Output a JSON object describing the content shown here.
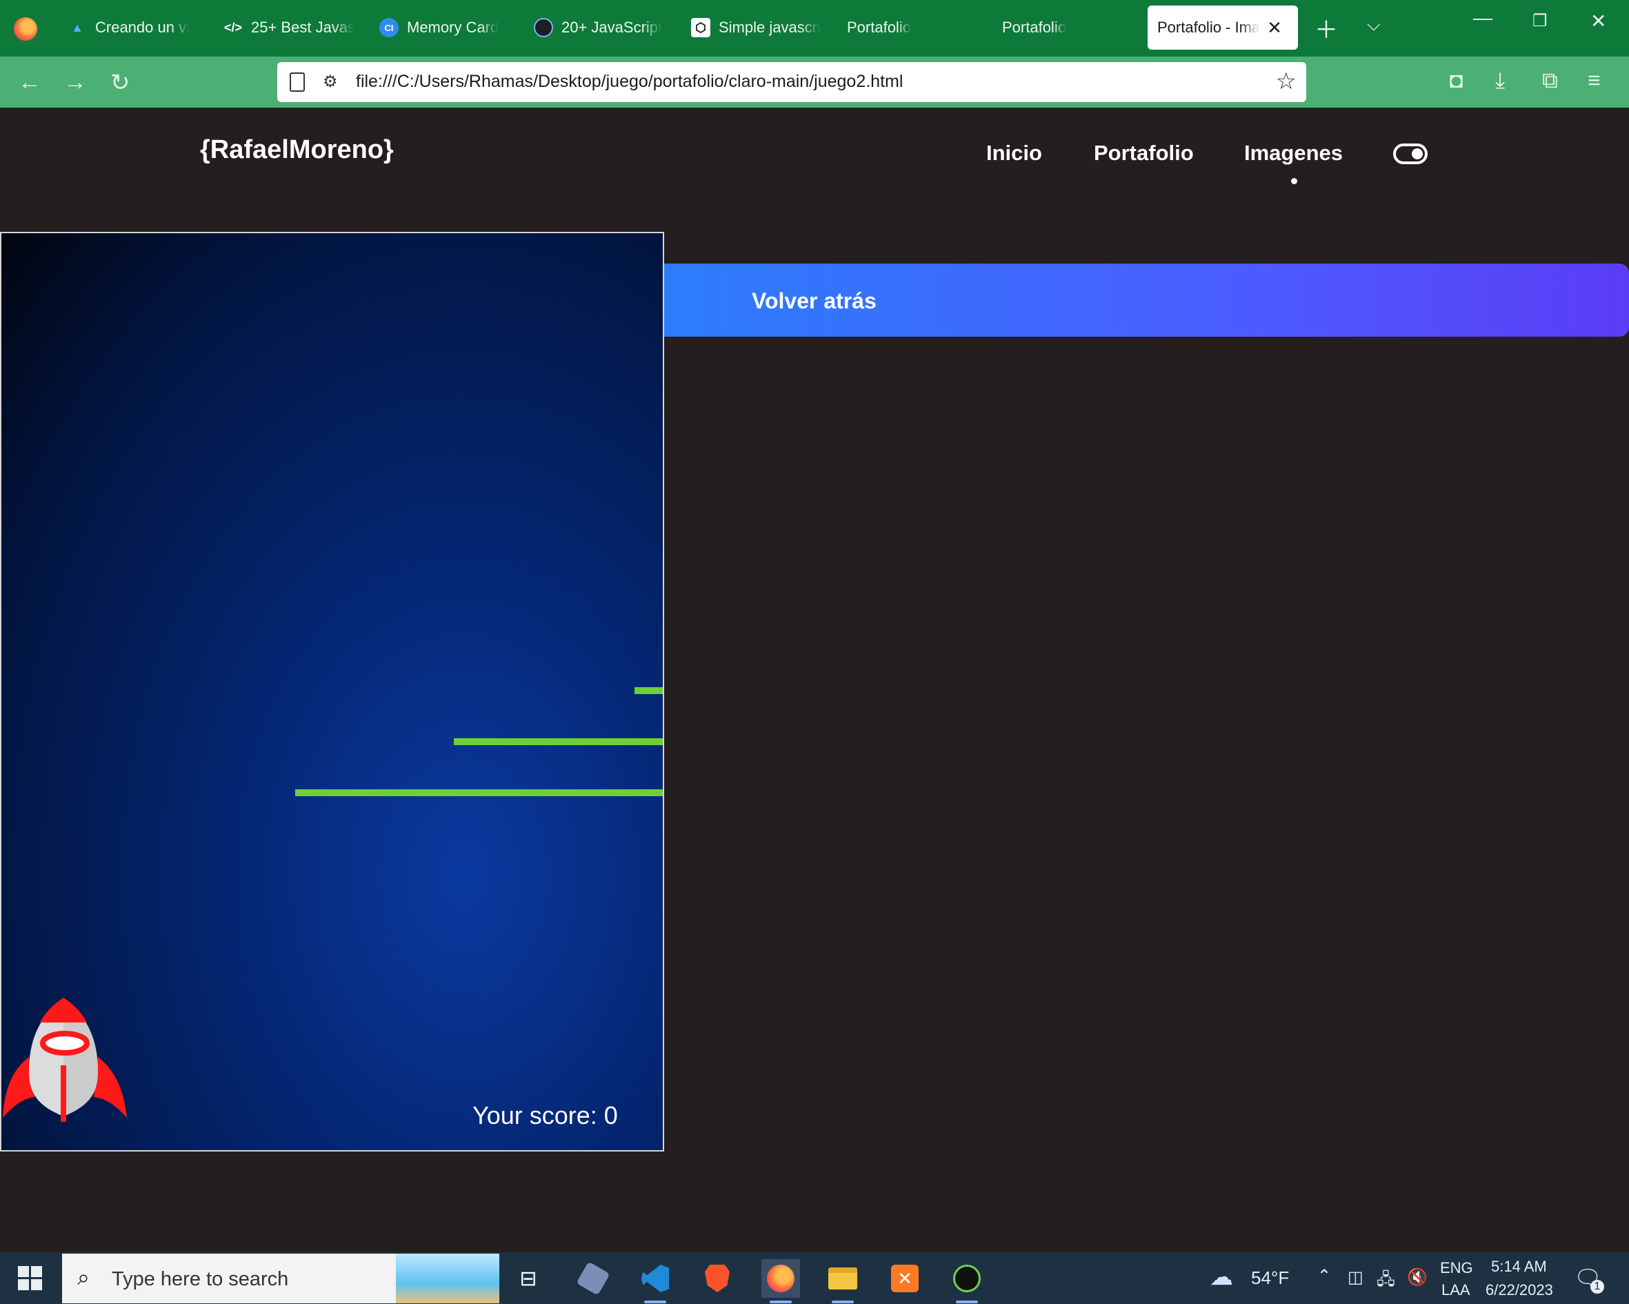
{
  "browser": {
    "tabs": [
      {
        "label": "Creando un vi",
        "icon": "triangle-a-icon",
        "active": false
      },
      {
        "label": "25+ Best Javas",
        "icon": "code-icon",
        "active": false
      },
      {
        "label": "Memory Card",
        "icon": "card-icon",
        "active": false
      },
      {
        "label": "20+ JavaScript",
        "icon": "github-icon",
        "active": false
      },
      {
        "label": "Simple javascri",
        "icon": "codepen-icon",
        "active": false
      },
      {
        "label": "Portafolio",
        "icon": "",
        "active": false
      },
      {
        "label": "Portafolio",
        "icon": "",
        "active": false
      },
      {
        "label": "Portafolio - Ima",
        "icon": "",
        "active": true
      }
    ],
    "url": "file:///C:/Users/Rhamas/Desktop/juego/portafolio/claro-main/juego2.html"
  },
  "site": {
    "brand": "{RafaelMoreno}",
    "nav": [
      {
        "label": "Inicio"
      },
      {
        "label": "Portafolio"
      },
      {
        "label": "Imagenes",
        "active": true
      }
    ],
    "back_button": "Volver atrás"
  },
  "game": {
    "score_label": "Your score: 0",
    "score": 0,
    "colors": {
      "bar": "#6fcf3b",
      "rocket_body": "#d9d9d9",
      "rocket_accent": "#ff1a1a"
    }
  },
  "taskbar": {
    "search_placeholder": "Type here to search",
    "weather": "54°F",
    "lang_line1": "ENG",
    "lang_line2": "LAA",
    "time": "5:14 AM",
    "date": "6/22/2023",
    "notification_count": "1"
  }
}
